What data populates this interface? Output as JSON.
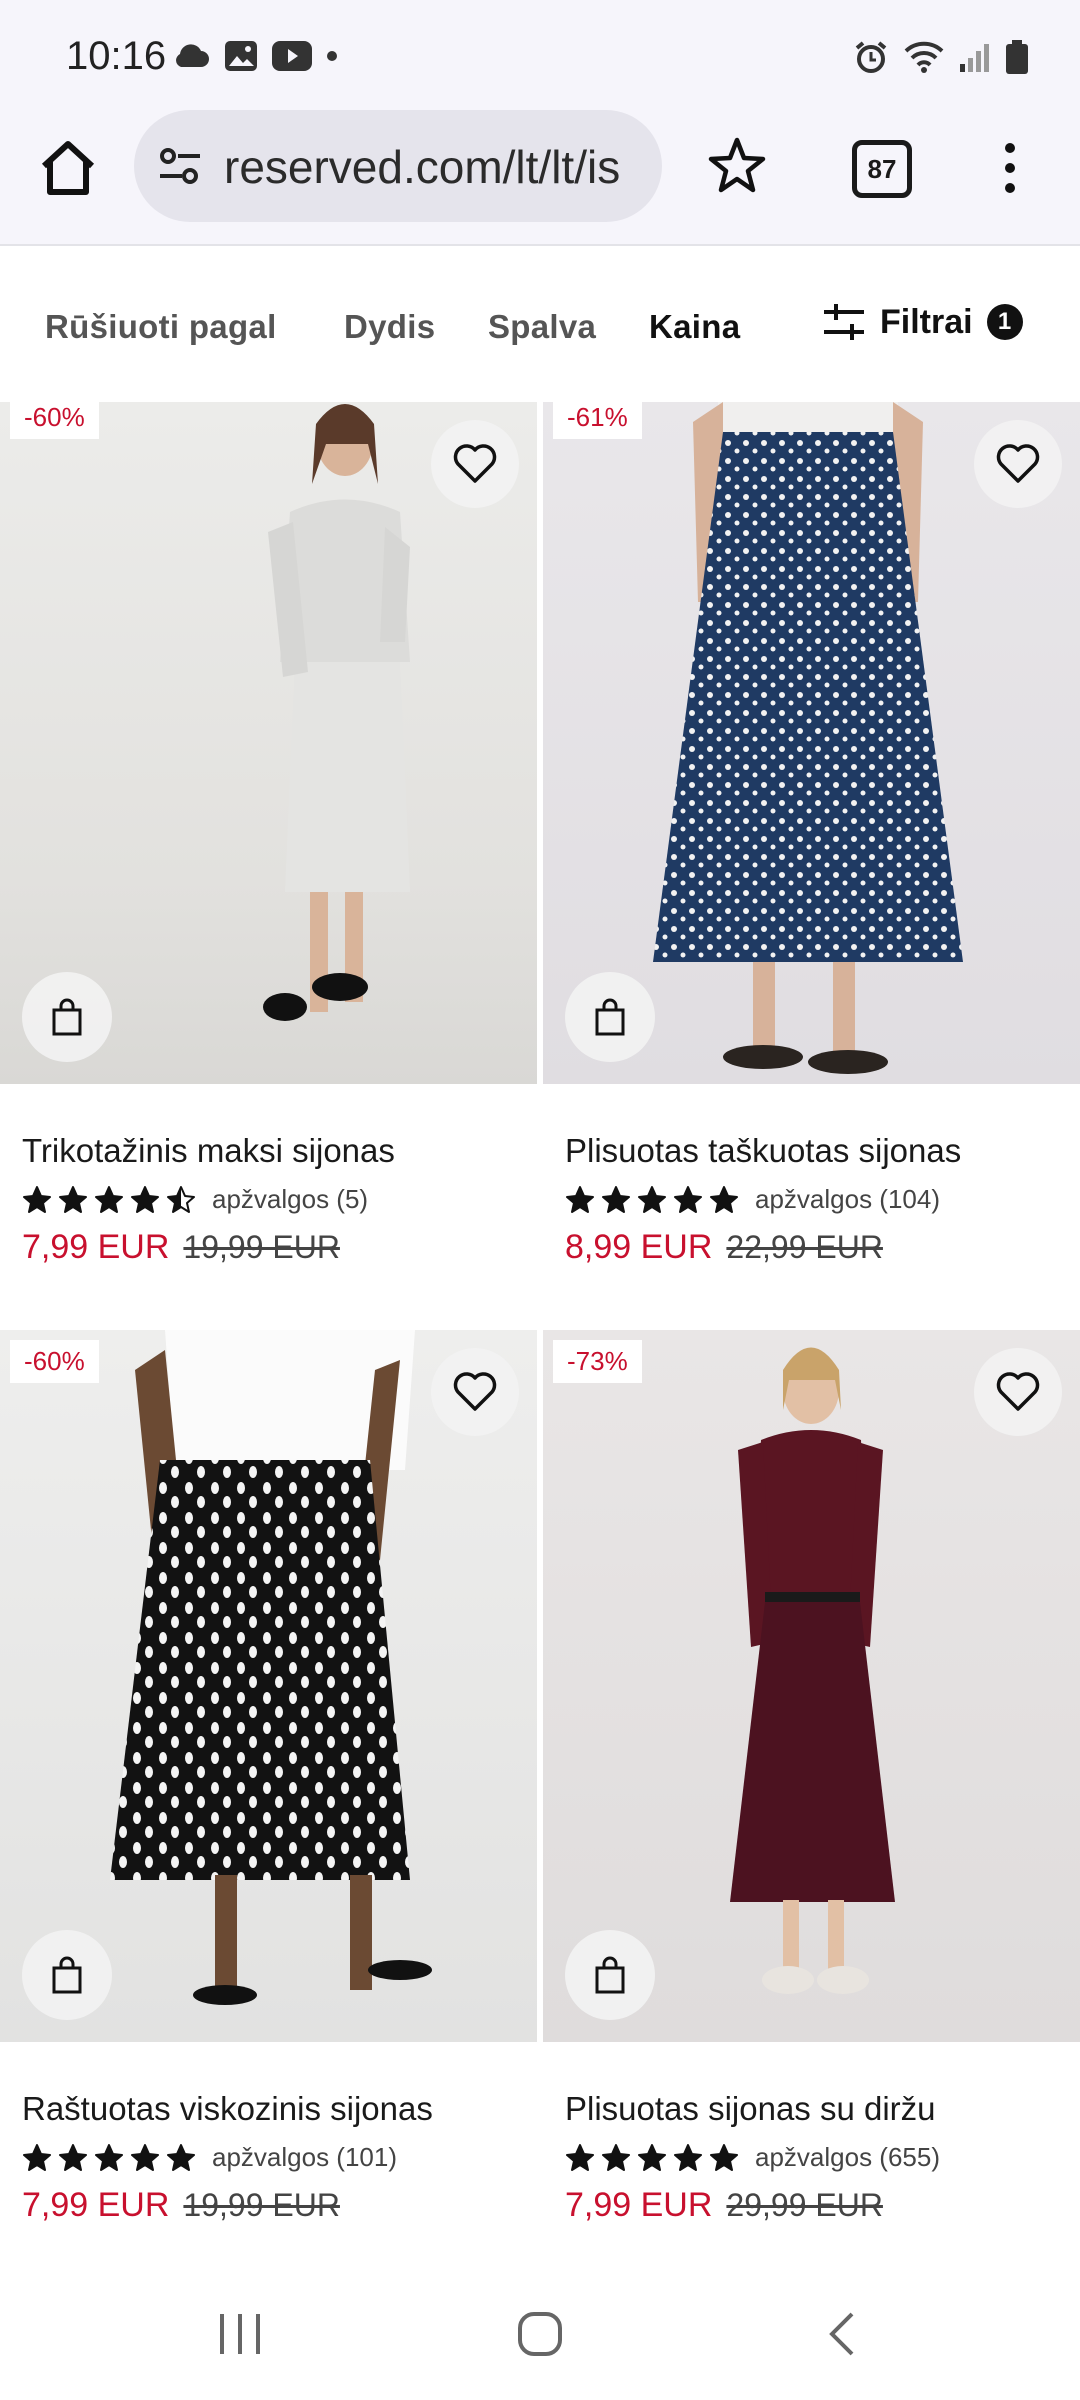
{
  "status_bar": {
    "time": "10:16"
  },
  "browser": {
    "url": "reserved.com/lt/lt/is",
    "tab_count": "87"
  },
  "filter_bar": {
    "sort_label": "Rūšiuoti pagal",
    "size_label": "Dydis",
    "color_label": "Spalva",
    "price_label": "Kaina",
    "filters_label": "Filtrai",
    "filters_count": "1"
  },
  "products": [
    {
      "discount": "-60%",
      "name": "Trikotažinis maksi sijonas",
      "rating": 4.5,
      "reviews": "apžvalgos (5)",
      "price": "7,99 EUR",
      "old_price": "19,99 EUR"
    },
    {
      "discount": "-61%",
      "name": "Plisuotas taškuotas sijonas",
      "rating": 5,
      "reviews": "apžvalgos (104)",
      "price": "8,99 EUR",
      "old_price": "22,99 EUR"
    },
    {
      "discount": "-60%",
      "name": "Raštuotas viskozinis sijonas",
      "rating": 5,
      "reviews": "apžvalgos (101)",
      "price": "7,99 EUR",
      "old_price": "19,99 EUR"
    },
    {
      "discount": "-73%",
      "name": "Plisuotas sijonas su diržu",
      "rating": 5,
      "reviews": "apžvalgos (655)",
      "price": "7,99 EUR",
      "old_price": "29,99 EUR"
    }
  ],
  "colors": {
    "sale_red": "#c8102e",
    "text_dark": "#1a1a1a",
    "chrome_bg": "#f6f5fb"
  },
  "icons": [
    "cloud-icon",
    "gallery-icon",
    "youtube-icon",
    "alarm-icon",
    "wifi-icon",
    "signal-icon",
    "battery-icon",
    "home-icon",
    "site-settings-icon",
    "star-icon",
    "tabs-icon",
    "menu-icon",
    "filters-icon",
    "heart-icon",
    "bag-icon",
    "recents-icon",
    "home-nav-icon",
    "back-icon"
  ]
}
